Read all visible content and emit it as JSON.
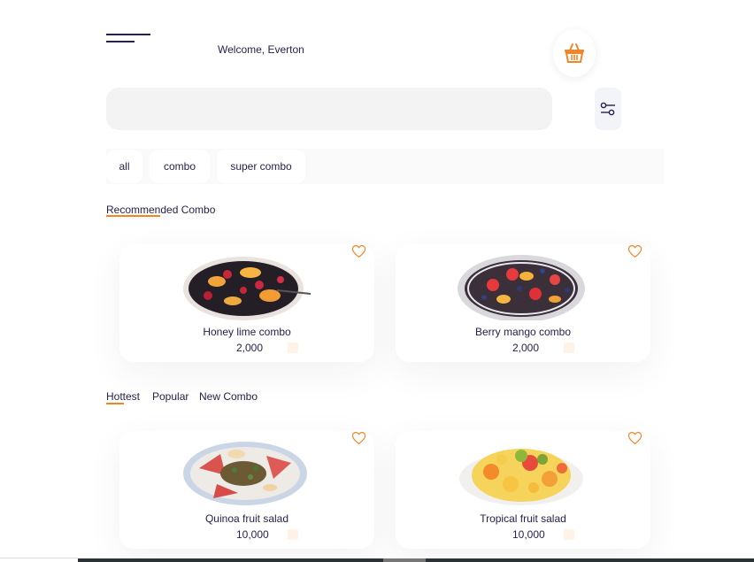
{
  "header": {
    "welcome_text": "Welcome, Everton",
    "menu_icon": "hamburger-menu-icon",
    "basket_icon": "basket-icon"
  },
  "search": {
    "placeholder": "",
    "filter_icon": "filter-settings-icon"
  },
  "categories": [
    {
      "label": "all"
    },
    {
      "label": "combo"
    },
    {
      "label": "super combo"
    }
  ],
  "recommended": {
    "title": "Recommended Combo",
    "items": [
      {
        "name": "Honey lime combo",
        "price": "2,000"
      },
      {
        "name": "Berry mango combo",
        "price": "2,000"
      }
    ]
  },
  "tabs": [
    {
      "label": "Hottest",
      "active": true
    },
    {
      "label": "Popular",
      "active": false
    },
    {
      "label": "New Combo",
      "active": false
    }
  ],
  "hottest": {
    "items": [
      {
        "name": "Quinoa fruit salad",
        "price": "10,000"
      },
      {
        "name": "Tropical fruit salad",
        "price": "10,000"
      }
    ]
  },
  "colors": {
    "accent": "#f08626",
    "text_dark": "#27214d",
    "search_bg": "#f3f3f3"
  }
}
